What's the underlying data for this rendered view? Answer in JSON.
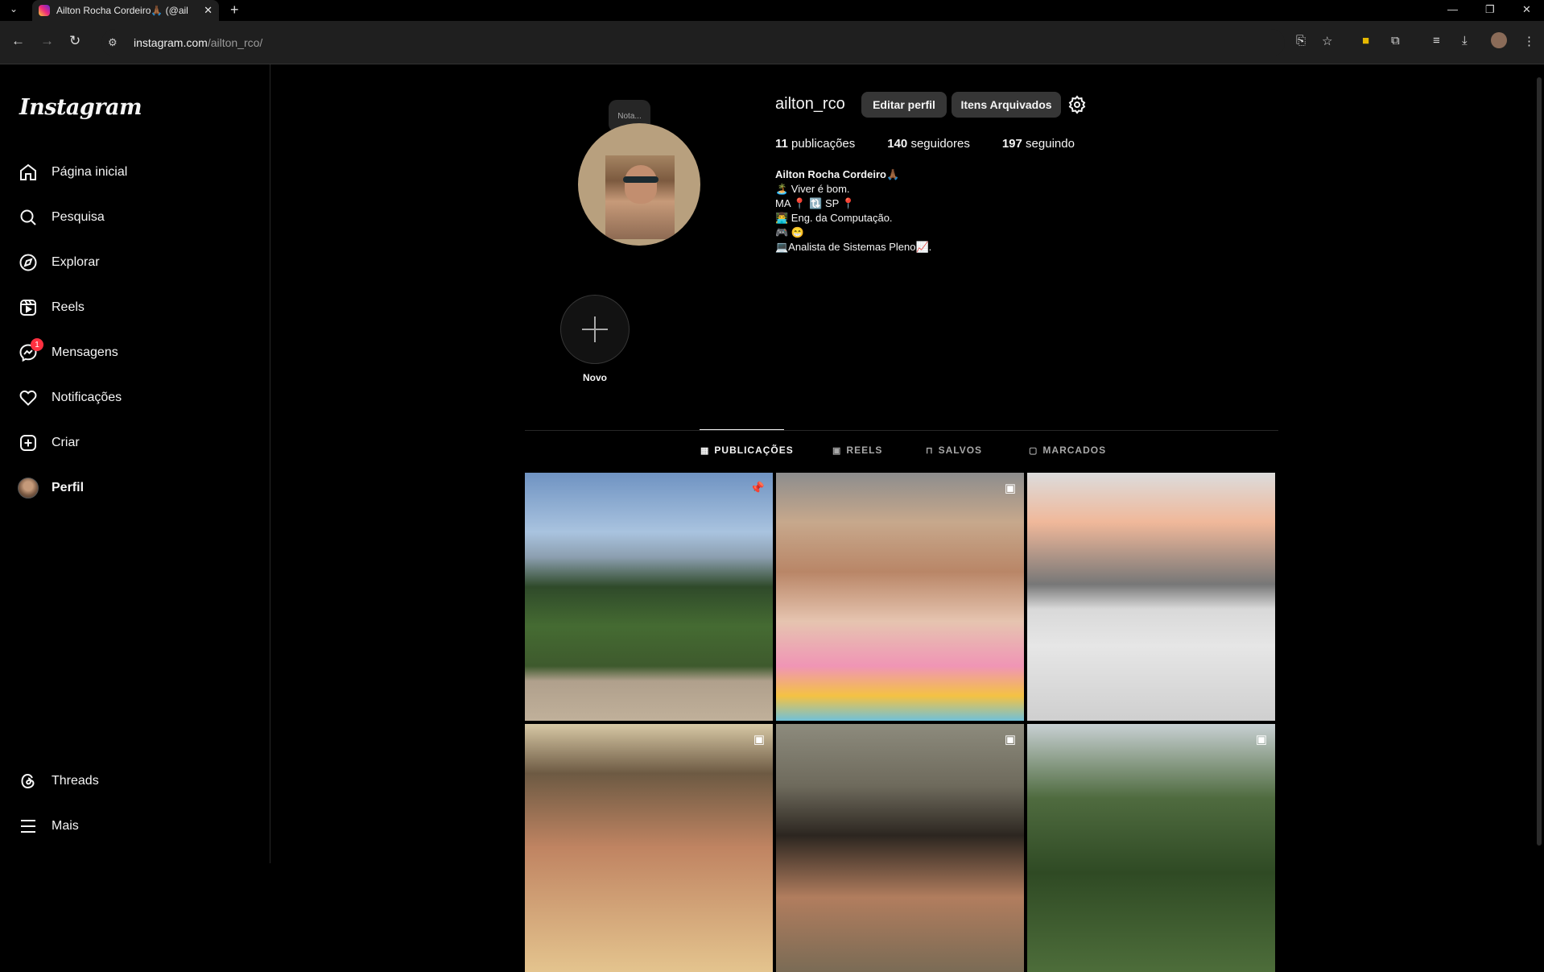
{
  "browser": {
    "tab_title": "Ailton Rocha Cordeiro🙏🏾 (@ail",
    "url_host": "instagram.com",
    "url_path": "/ailton_rco/"
  },
  "sidebar": {
    "logo": "Instagram",
    "items": [
      {
        "label": "Página inicial",
        "icon": "home-icon"
      },
      {
        "label": "Pesquisa",
        "icon": "search-icon"
      },
      {
        "label": "Explorar",
        "icon": "compass-icon"
      },
      {
        "label": "Reels",
        "icon": "reels-icon"
      },
      {
        "label": "Mensagens",
        "icon": "messenger-icon",
        "badge": "1"
      },
      {
        "label": "Notificações",
        "icon": "heart-icon"
      },
      {
        "label": "Criar",
        "icon": "plus-square-icon"
      },
      {
        "label": "Perfil",
        "icon": "avatar"
      }
    ],
    "bottom": [
      {
        "label": "Threads",
        "icon": "threads-icon"
      },
      {
        "label": "Mais",
        "icon": "menu-icon"
      }
    ]
  },
  "profile": {
    "note": "Nota...",
    "username": "ailton_rco",
    "edit_button": "Editar perfil",
    "archive_button": "Itens Arquivados",
    "posts_count": "11",
    "posts_label": "publicações",
    "followers_count": "140",
    "followers_label": "seguidores",
    "following_count": "197",
    "following_label": "seguindo",
    "bio": {
      "name": "Ailton Rocha Cordeiro🙏🏾",
      "lines": [
        "🏝️ Viver é bom.",
        "MA 📍 🔃 SP 📍",
        "👨‍💻 Eng. da Computação.",
        "🎮 😁",
        "💻Analista de Sistemas Pleno📈."
      ]
    },
    "highlight_label": "Novo"
  },
  "tabs": [
    {
      "label": "PUBLICAÇÕES",
      "icon": "grid-icon",
      "active": true
    },
    {
      "label": "REELS",
      "icon": "reels-icon",
      "active": false
    },
    {
      "label": "SALVOS",
      "icon": "bookmark-icon",
      "active": false
    },
    {
      "label": "MARCADOS",
      "icon": "tagged-icon",
      "active": false
    }
  ],
  "grid": [
    {
      "marker": "pin-icon"
    },
    {
      "marker": "reel-icon"
    },
    {
      "marker": ""
    },
    {
      "marker": "reel-icon"
    },
    {
      "marker": "reel-icon"
    },
    {
      "marker": "reel-icon"
    }
  ]
}
